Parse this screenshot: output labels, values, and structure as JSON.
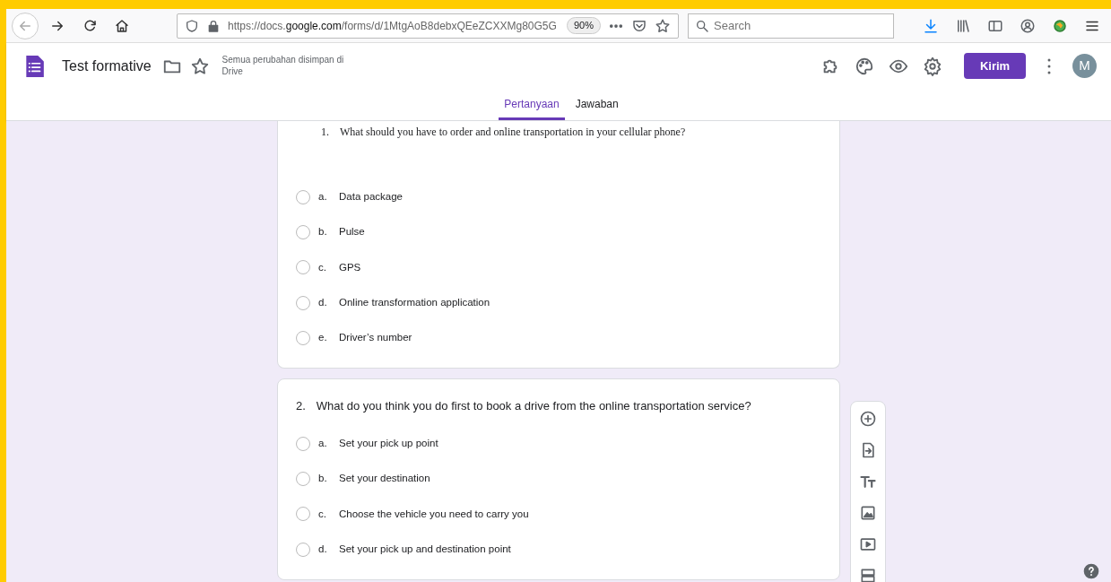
{
  "browser": {
    "url": {
      "scheme": "https://docs.",
      "domain": "google.com",
      "path": "/forms/d/1MtgAoB8debxQEeZCXXMg80G5G"
    },
    "zoom": "90%",
    "search": {
      "placeholder": "Search"
    }
  },
  "app": {
    "title": "Test formative",
    "save_status": "Semua perubahan disimpan di Drive",
    "send_button": "Kirim",
    "avatar": "M"
  },
  "tabs": [
    {
      "label": "Pertanyaan",
      "selected": true
    },
    {
      "label": "Jawaban",
      "selected": false
    }
  ],
  "questions": [
    {
      "number": "1.",
      "text": "What should you have to order and online transportation in your cellular phone?",
      "kind": "pasted",
      "options": [
        {
          "letter": "a.",
          "text": "Data package",
          "selected": false
        },
        {
          "letter": "b.",
          "text": "Pulse",
          "selected": false
        },
        {
          "letter": "c.",
          "text": "GPS",
          "selected": false
        },
        {
          "letter": "d.",
          "text": "Online transformation application",
          "selected": false
        },
        {
          "letter": "e.",
          "text": "Driver’s number",
          "selected": false
        }
      ]
    },
    {
      "number": "2.",
      "text": "What do you think you do first to book a drive from the online transportation service?",
      "kind": "plain",
      "options": [
        {
          "letter": "a.",
          "text": "Set your pick up point",
          "selected": false
        },
        {
          "letter": "b.",
          "text": "Set your destination",
          "selected": false
        },
        {
          "letter": "c.",
          "text": "Choose the vehicle you need to carry you",
          "selected": false
        },
        {
          "letter": "d.",
          "text": "Set your pick up and destination point",
          "selected": false
        }
      ]
    }
  ]
}
